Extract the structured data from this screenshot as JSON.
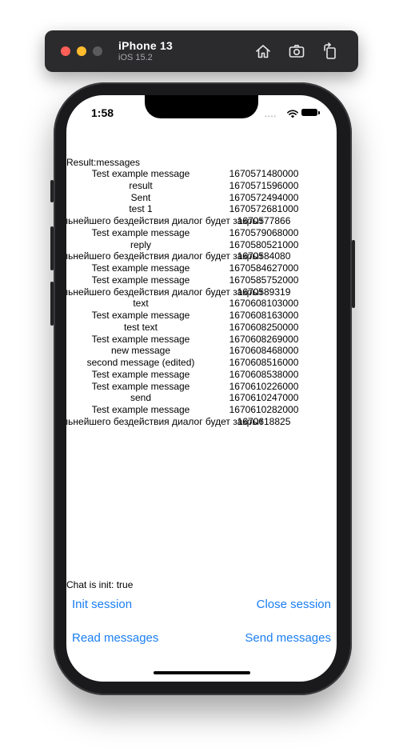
{
  "toolbar": {
    "device_name": "iPhone 13",
    "os_version": "iOS 15.2"
  },
  "status_bar": {
    "time": "1:58"
  },
  "result": {
    "title": "Result:messages",
    "messages": [
      {
        "text": "Test example message",
        "time": "1670571480000"
      },
      {
        "text": "result",
        "time": "1670571596000"
      },
      {
        "text": "Sent",
        "time": "1670572494000"
      },
      {
        "text": "test 1",
        "time": "1670572681000"
      },
      {
        "text": "случае дальнейшего бездействия диалог будет закрыт",
        "time": "1670577866"
      },
      {
        "text": "Test example message",
        "time": "1670579068000"
      },
      {
        "text": "reply",
        "time": "1670580521000"
      },
      {
        "text": "случае дальнейшего бездействия диалог будет закрыт",
        "time": "1670584080"
      },
      {
        "text": "Test example message",
        "time": "1670584627000"
      },
      {
        "text": "Test example message",
        "time": "1670585752000"
      },
      {
        "text": "случае дальнейшего бездействия диалог будет закрыт",
        "time": "1670589319"
      },
      {
        "text": "text",
        "time": "1670608103000"
      },
      {
        "text": "Test example message",
        "time": "1670608163000"
      },
      {
        "text": "test text",
        "time": "1670608250000"
      },
      {
        "text": "Test example message",
        "time": "1670608269000"
      },
      {
        "text": "new message",
        "time": "1670608468000"
      },
      {
        "text": "second message (edited)",
        "time": "1670608516000"
      },
      {
        "text": "Test example message",
        "time": "1670608538000"
      },
      {
        "text": "Test example message",
        "time": "1670610226000"
      },
      {
        "text": "send",
        "time": "1670610247000"
      },
      {
        "text": "Test example message",
        "time": "1670610282000"
      },
      {
        "text": "случае дальнейшего бездействия диалог будет закрыт",
        "time": "1670618825"
      }
    ]
  },
  "chat_status": "Chat is init: true",
  "actions": {
    "init": "Init session",
    "close": "Close session",
    "read": "Read messages",
    "send": "Send messages"
  },
  "colors": {
    "accent": "#1a7ef2",
    "toolbar": "#2b2b2d"
  }
}
